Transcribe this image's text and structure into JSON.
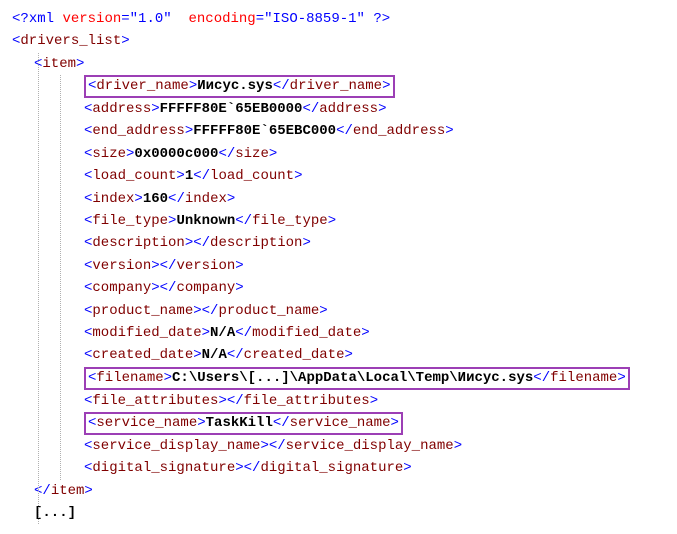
{
  "xml_decl": {
    "target": "xml",
    "attr1_name": "version",
    "attr1_value": "\"1.0\"",
    "attr2_name": "encoding",
    "attr2_value": "\"ISO-8859-1\""
  },
  "tags": {
    "drivers_list": "drivers_list",
    "item": "item",
    "driver_name": "driver_name",
    "address": "address",
    "end_address": "end_address",
    "size": "size",
    "load_count": "load_count",
    "index": "index",
    "file_type": "file_type",
    "description": "description",
    "version": "version",
    "company": "company",
    "product_name": "product_name",
    "modified_date": "modified_date",
    "created_date": "created_date",
    "filename": "filename",
    "file_attributes": "file_attributes",
    "service_name": "service_name",
    "service_display_name": "service_display_name",
    "digital_signature": "digital_signature"
  },
  "values": {
    "driver_name": "Иисус.sys",
    "address": "FFFFF80E`65EB0000",
    "end_address": "FFFFF80E`65EBC000",
    "size": "0x0000c000",
    "load_count": "1",
    "index": "160",
    "file_type": "Unknown",
    "description": "",
    "version": "",
    "company": "",
    "product_name": "",
    "modified_date": "N/A",
    "created_date": "N/A",
    "filename": "C:\\Users\\[...]\\AppData\\Local\\Temp\\Иисус.sys",
    "file_attributes": "",
    "service_name": "TaskKill",
    "service_display_name": "",
    "digital_signature": ""
  },
  "ellipsis": "[...]",
  "highlight_color": "#9c3fb5"
}
